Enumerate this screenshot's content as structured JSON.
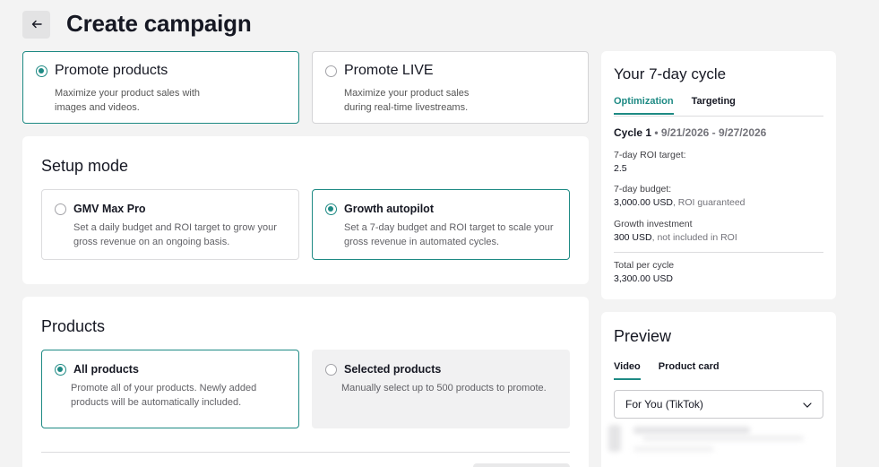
{
  "header": {
    "title": "Create campaign",
    "back_icon": "arrow-left-icon"
  },
  "campaign_types": [
    {
      "title": "Promote products",
      "desc": "Maximize your product sales with images and videos.",
      "selected": true
    },
    {
      "title": "Promote LIVE",
      "desc": "Maximize your product sales during real-time livestreams.",
      "selected": false
    }
  ],
  "setup_mode": {
    "title": "Setup mode",
    "options": [
      {
        "title": "GMV Max Pro",
        "desc": "Set a daily budget and ROI target to grow your gross revenue on an ongoing basis.",
        "selected": false
      },
      {
        "title": "Growth autopilot",
        "desc": "Set a 7-day budget and ROI target to scale your gross revenue in automated cycles.",
        "selected": true
      }
    ]
  },
  "products": {
    "title": "Products",
    "options": [
      {
        "title": "All products",
        "desc": "Promote all of your products. Newly added products will be automatically included.",
        "selected": true
      },
      {
        "title": "Selected products",
        "desc": "Manually select up to 500 products to promote.",
        "selected": false
      }
    ]
  },
  "cycle_panel": {
    "title": "Your 7-day cycle",
    "tabs": [
      "Optimization",
      "Targeting"
    ],
    "cycle_label": "Cycle 1",
    "cycle_dates": "9/21/2026 - 9/27/2026",
    "roi_label": "7-day ROI target:",
    "roi_value": "2.5",
    "budget_label": "7-day budget:",
    "budget_value": "3,000.00 USD",
    "budget_note": ", ROI guaranteed",
    "growth_label": "Growth investment",
    "growth_value": "300 USD",
    "growth_note": ", not included in ROI",
    "total_label": "Total per cycle",
    "total_value": "3,300.00 USD"
  },
  "preview_panel": {
    "title": "Preview",
    "tabs": [
      "Video",
      "Product card"
    ],
    "select_value": "For You (TikTok)"
  },
  "colors": {
    "accent": "#1e8a84",
    "background": "#f3f3f3",
    "text": "#161823"
  }
}
